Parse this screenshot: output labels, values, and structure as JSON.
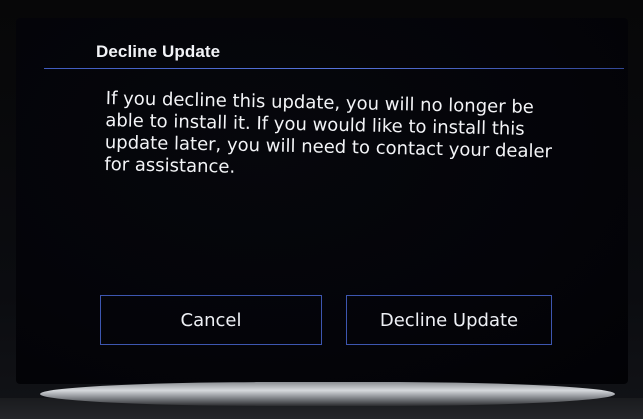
{
  "dialog": {
    "title": "Decline Update",
    "message": "If you decline this update, you will no longer be able to install it. If you would like to install this update later, you will need to contact your dealer for assistance."
  },
  "buttons": {
    "cancel_label": "Cancel",
    "decline_label": "Decline Update"
  },
  "colors": {
    "background": "#040409",
    "text": "#f3f4f7",
    "accent_line": "#4a64d2",
    "button_border": "#3d56b0"
  }
}
